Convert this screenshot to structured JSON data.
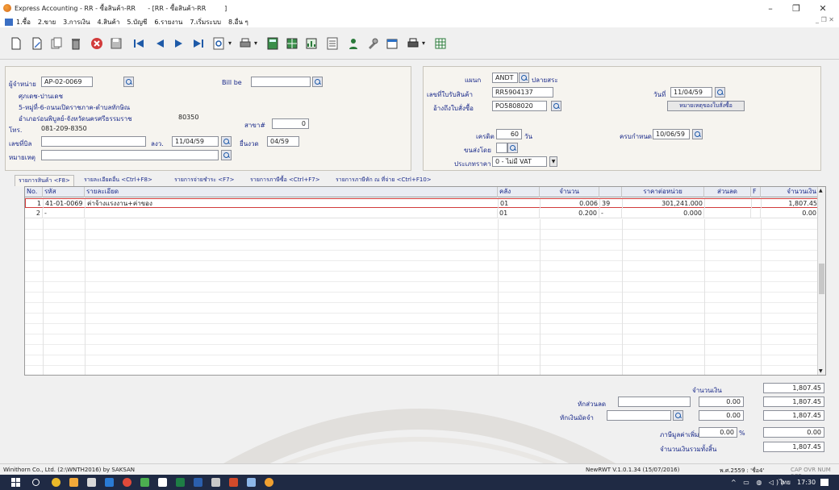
{
  "window": {
    "title": "Express Accounting - RR - ซื้อสินค้า-RR      - [RR - ซื้อสินค้า-RR         ]",
    "controls": {
      "minimize": "–",
      "maximize": "❐",
      "close": "✕"
    }
  },
  "menu": {
    "items": [
      "1.ซื้อ",
      "2.ขาย",
      "3.การเงิน",
      "4.สินค้า",
      "5.บัญชี",
      "6.รายงาน",
      "7.เริ่มระบบ",
      "8.อื่น ๆ"
    ],
    "mdi_controls": "_ ❐ ✕"
  },
  "toolbar": {
    "icons": [
      "new-document-icon",
      "edit-icon",
      "copy-icon",
      "trash-icon",
      "cancel-icon",
      "save-icon",
      "first-record-icon",
      "prev-record-icon",
      "next-record-icon",
      "last-record-icon",
      "search-icon",
      "print-icon",
      "calculator-icon",
      "grid-icon",
      "chart-icon",
      "list-icon",
      "user-icon",
      "tools-icon",
      "calendar-icon",
      "printer-icon",
      "table-icon"
    ]
  },
  "header": {
    "vendor_label": "ผู้จำหน่าย",
    "vendor_code": "AP-02-0069",
    "vendor_name": "ศุภเดช-ปานเดช",
    "vendor_address1": "5-หมู่ที่-6-ถนนเปิดราชภาค-ตำบลทักษิณ",
    "vendor_address2": "อำเภอร่อนพิบูลย์-จังหวัดนครศรีธรรมราช",
    "postcode": "80350",
    "tel_label": "โทร.",
    "tel": "081-209-8350",
    "bill_label": "Bill be",
    "bill_value": "",
    "branch_label": "สาขา#",
    "branch_value": "0",
    "invoice_no_label": "เลขที่บิล",
    "invoice_no": "",
    "tax_date_label": "ลงว.",
    "tax_date": "11/04/59",
    "tax_period_label": "ยื่นงวด",
    "tax_period": "04/59",
    "remark_label": "หมายเหตุ",
    "remark": "",
    "dept_label": "แผนก",
    "dept_code": "ANDT",
    "dept_name": "ปลายสระ",
    "receipt_label": "เลขที่ใบรับสินค้า",
    "receipt_no": "RR5904137",
    "po_label": "อ้างถึงใบสั่งซื้อ",
    "po_no": "PO5808020",
    "date_label": "วันที่",
    "date": "11/04/59",
    "po_note_button": "หมายเหตุของใบสั่งซื้อ",
    "credit_label": "เครดิต",
    "credit_days": "60",
    "credit_unit": "วัน",
    "due_label": "ครบกำหนด",
    "due_date": "10/06/59",
    "ship_label": "ขนส่งโดย",
    "ship_value": "",
    "vat_type_label": "ประเภทราคา",
    "vat_type": "0 - ไม่มี VAT"
  },
  "tabs": [
    "รายการสินค้า <F8>",
    "รายละเอียดอื่น <Ctrl+F8>",
    "รายการจ่ายชำระ <F7>",
    "รายการภาษีซื้อ <Ctrl+F7>",
    "รายการภาษีหัก ณ ที่จ่าย <Ctrl+F10>"
  ],
  "grid": {
    "columns": [
      "No.",
      "รหัส",
      "รายละเอียด",
      "คลัง",
      "จำนวน",
      "ราคาต่อหน่วย",
      "ส่วนลด",
      "F",
      "จำนวนเงิน"
    ],
    "rows": [
      {
        "no": "1",
        "code": "41-01-0069",
        "desc": "ค่าจ้างแรงงาน+ค่าของ",
        "wh": "01",
        "qty": "0.006",
        "unit": "39",
        "price": "301,241.000",
        "disc": "",
        "f": "",
        "amount": "1,807.45"
      },
      {
        "no": "2",
        "code": "-",
        "desc": "",
        "wh": "01",
        "qty": "0.200",
        "unit": "-",
        "price": "0.000",
        "disc": "",
        "f": "",
        "amount": "0.00"
      }
    ]
  },
  "totals": {
    "amount_label": "จำนวนเงิน",
    "amount": "1,807.45",
    "discount_label": "หักส่วนลด",
    "discount_input": "",
    "discount_value": "0.00",
    "after_discount": "1,807.45",
    "deposit_label": "หักเงินมัดจำ",
    "deposit_input": "",
    "deposit_value": "0.00",
    "after_deposit": "1,807.45",
    "vat_label": "ภาษีมูลค่าเพิ่ม",
    "vat_rate": "0.00",
    "vat_pct": "%",
    "vat_value": "0.00",
    "grand_label": "จำนวนเงินรวมทั้งสิ้น",
    "grand_total": "1,807.45"
  },
  "status": {
    "company": "Winithorn Co., Ltd. (2:\\WNTH2016) by SAKSAN",
    "version": "NewRWT V.1.0.1.34 (15/07/2016)",
    "period": "พ.ศ.2559 : 'ชื่อ4'",
    "keys": "CAP OVR NUM SCR"
  },
  "taskbar": {
    "time": "17:30",
    "lang": "ไทย",
    "tray": "^ ▭ ◍ ◁))"
  },
  "colors": {
    "label_blue": "#1a2a8a",
    "row_selected_border": "#d23b3b",
    "taskbar": "#1f2a44"
  }
}
